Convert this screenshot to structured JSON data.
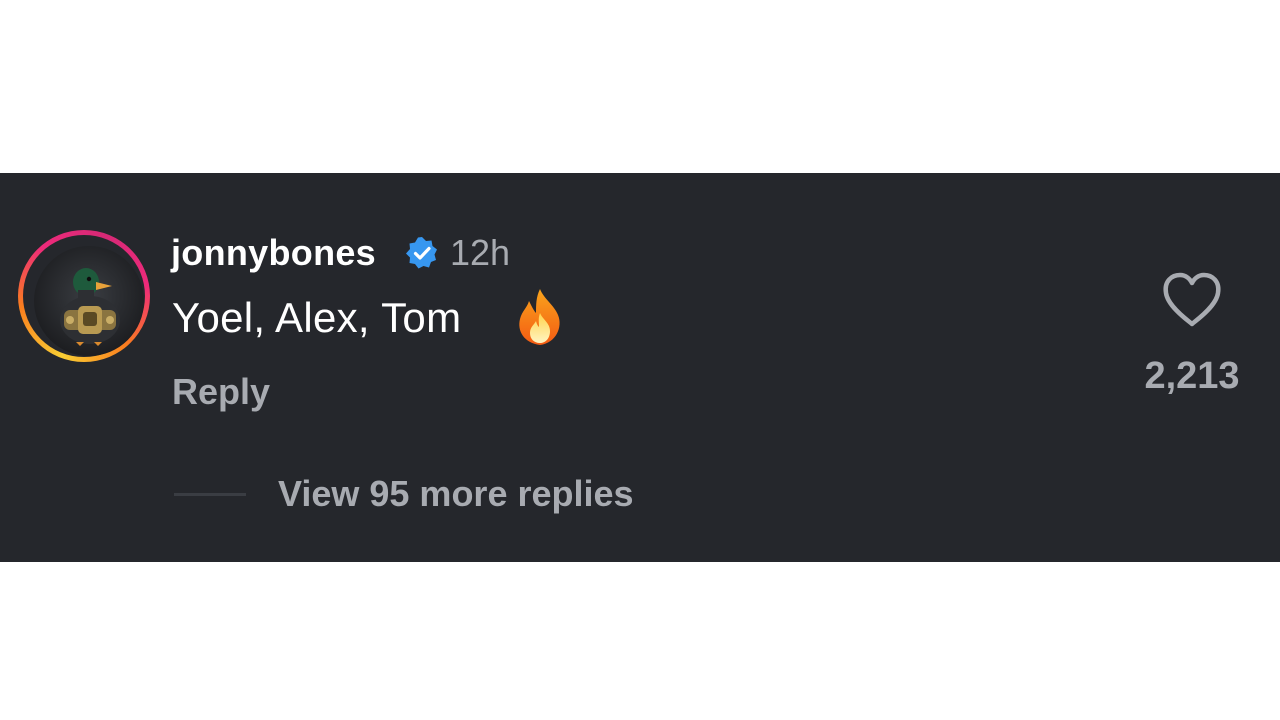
{
  "comment": {
    "username": "jonnybones",
    "verified_icon": "verified-badge-icon",
    "timestamp": "12h",
    "text": "Yoel, Alex, Tom",
    "emoji_icon": "fire-icon",
    "reply_label": "Reply",
    "view_replies_label": "View 95 more replies",
    "likes": "2,213",
    "like_icon": "heart-outline-icon"
  },
  "colors": {
    "panel_background": "#25272c",
    "primary_text": "#ffffff",
    "secondary_text": "#a8abb1",
    "verified_blue": "#3797f0",
    "avatar_ring_start": "#f9ce34",
    "avatar_ring_end": "#ee2a7b"
  }
}
